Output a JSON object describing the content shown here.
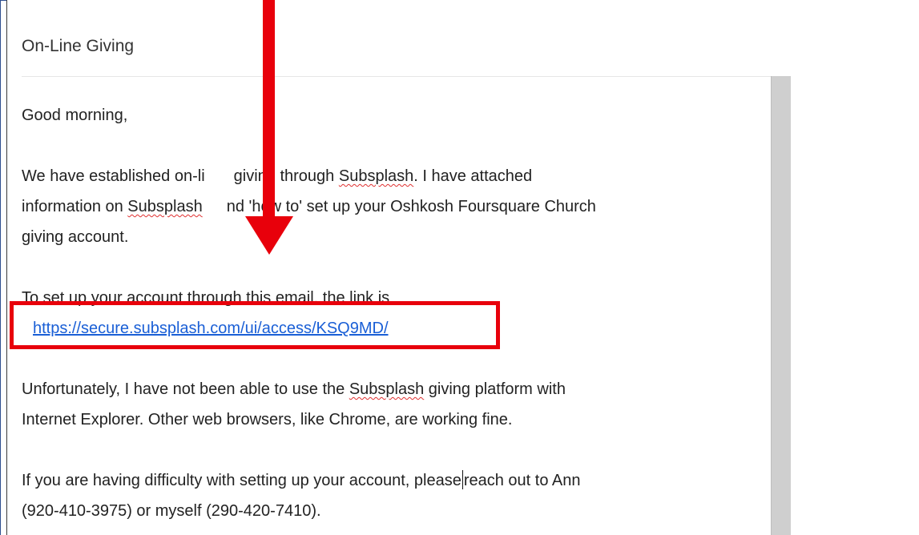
{
  "email": {
    "subject": "On-Line Giving",
    "greeting": "Good morning,",
    "p1": {
      "a": "We have established on-li",
      "b": "giving through ",
      "c": "Subsplash",
      "d": ". I have attached",
      "e": "information on ",
      "f": "Subsplash",
      "g": "nd 'how to' set up your Oshkosh Foursquare Church",
      "h": "giving account."
    },
    "p2": {
      "a": "To set up your account through this email, the link is",
      "link": "https://secure.subsplash.com/ui/access/KSQ9MD/"
    },
    "p3": {
      "a": "Unfortunately, I have not been able to use the ",
      "b": "Subsplash",
      "c": " giving platform with",
      "d": "Internet Explorer. Other web browsers, like Chrome, are working fine."
    },
    "p4": {
      "a": "If you are having difficulty with setting up your account, please",
      "b": "reach out to Ann",
      "c": "(920-410-3975) or myself (290-420-7410)."
    }
  },
  "annotation": {
    "color": "#e8000b",
    "arrow_icon": "down-arrow-icon"
  },
  "colors": {
    "link": "#1a5fd6",
    "spellcheck": "#e03030",
    "frame_border": "#2f4f8f"
  }
}
